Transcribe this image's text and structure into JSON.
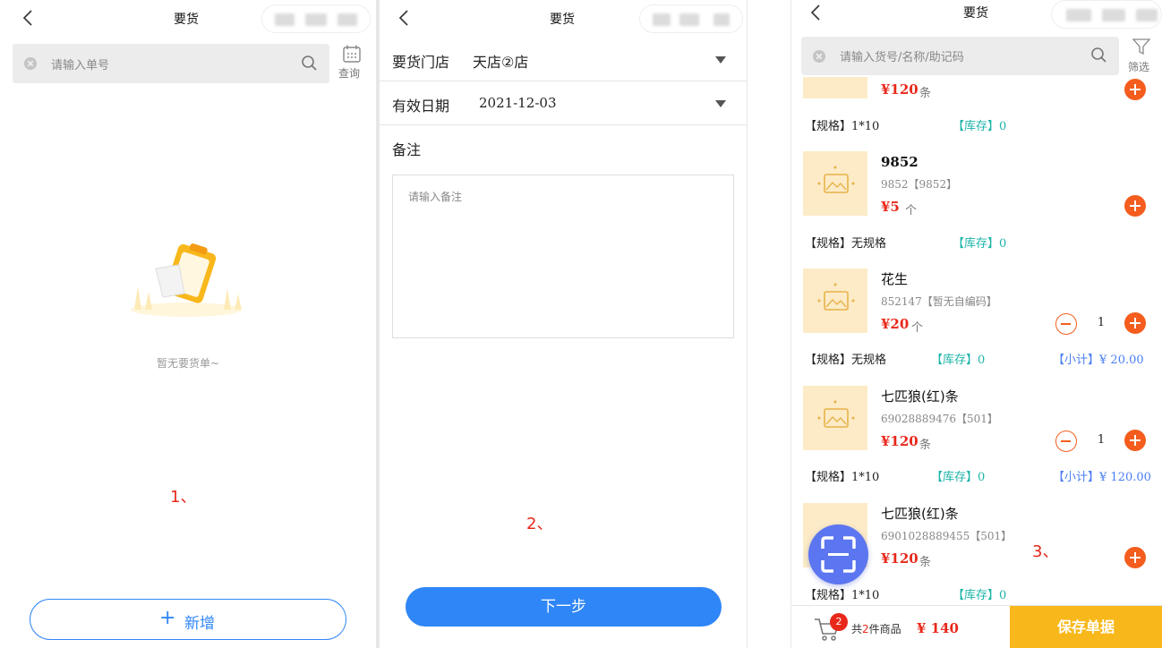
{
  "screen1": {
    "title": "要货",
    "search_placeholder": "请输入单号",
    "query_label": "查询",
    "empty_text": "暂无要货单~",
    "add_label": "新增",
    "annotation": "1、"
  },
  "screen2": {
    "title": "要货",
    "store_label": "要货门店",
    "store_value": "天店②店",
    "date_label": "有效日期",
    "date_value": "2021-12-03",
    "remark_label": "备注",
    "remark_placeholder": "请输入备注",
    "next_label": "下一步",
    "annotation": "2、"
  },
  "screen3": {
    "title": "要货",
    "search_placeholder": "请输入货号/名称/助记码",
    "filter_label": "筛选",
    "annotation": "3、",
    "spec_prefix": "【规格】",
    "stock_prefix": "【库存】",
    "subtotal_prefix": "【小计】",
    "items": [
      {
        "name": "",
        "code": "",
        "price": "¥120",
        "unit": "条",
        "spec": "1*10",
        "stock": "0",
        "qty": "",
        "subtotal": ""
      },
      {
        "name": "9852",
        "code": "9852【9852】",
        "price": "¥5",
        "unit": "个",
        "spec": "无规格",
        "stock": "0",
        "qty": "",
        "subtotal": ""
      },
      {
        "name": "花生",
        "code": "852147【暂无自编码】",
        "price": "¥20",
        "unit": "个",
        "spec": "无规格",
        "stock": "0",
        "qty": "1",
        "subtotal": "¥ 20.00"
      },
      {
        "name": "七匹狼(红)条",
        "code": "69028889476【501】",
        "price": "¥120",
        "unit": "条",
        "spec": "1*10",
        "stock": "0",
        "qty": "1",
        "subtotal": "¥ 120.00"
      },
      {
        "name": "七匹狼(红)条",
        "code": "6901028889455【501】",
        "price": "¥120",
        "unit": "条",
        "spec": "1*10",
        "stock": "0",
        "qty": "",
        "subtotal": ""
      }
    ],
    "cart_badge": "2",
    "cart_text_pre": "共",
    "cart_text_num": "2",
    "cart_text_post": "件商品",
    "cart_total": "¥ 140",
    "save_label": "保存单据"
  },
  "colors": {
    "primary_blue": "#2f86f6",
    "save_yellow": "#f8b81b",
    "price_red": "#e8281a",
    "stock_teal": "#1bb3a8",
    "subtotal_blue": "#4a7ef2",
    "add_orange": "#f45d1d",
    "scan_blue": "#5b76f0"
  }
}
